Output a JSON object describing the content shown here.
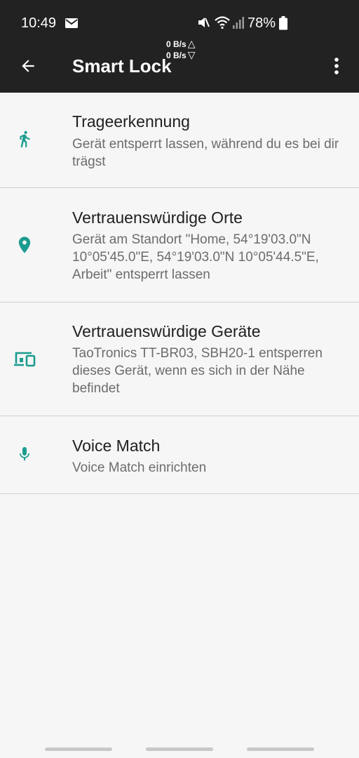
{
  "status_bar": {
    "time": "10:49",
    "battery": "78%",
    "icons": [
      "mail-icon",
      "mute-icon",
      "wifi-icon",
      "signal-icon",
      "battery-icon"
    ]
  },
  "app_bar": {
    "title": "Smart Lock",
    "net_up": "0 B/s",
    "net_down": "0 B/s",
    "up_arrow": "△",
    "down_arrow": "▽",
    "icons": [
      "back-arrow-icon",
      "more-vert-icon"
    ]
  },
  "items": [
    {
      "title": "Trageerkennung",
      "subtitle": "Gerät entsperrt lassen, während du es bei dir trägst",
      "icon": "walking-person-icon"
    },
    {
      "title": "Vertrauenswürdige Orte",
      "subtitle": "Gerät am Standort \"Home, 54°19'03.0\"N 10°05'45.0\"E, 54°19'03.0\"N 10°05'44.5\"E, Arbeit\" entsperrt lassen",
      "icon": "location-pin-icon"
    },
    {
      "title": "Vertrauenswürdige Geräte",
      "subtitle": "TaoTronics TT-BR03, SBH20-1 entsperren dieses Gerät, wenn es sich in der Nähe befindet",
      "icon": "devices-icon"
    },
    {
      "title": "Voice Match",
      "subtitle": "Voice Match einrichten",
      "icon": "microphone-icon"
    }
  ],
  "colors": {
    "bar_background": "#222222",
    "page_background": "#f6f6f6",
    "accent": "#1b9c8f",
    "title_text": "#202020",
    "subtitle_text": "#6c6c6c",
    "divider": "#cfcfcf"
  }
}
